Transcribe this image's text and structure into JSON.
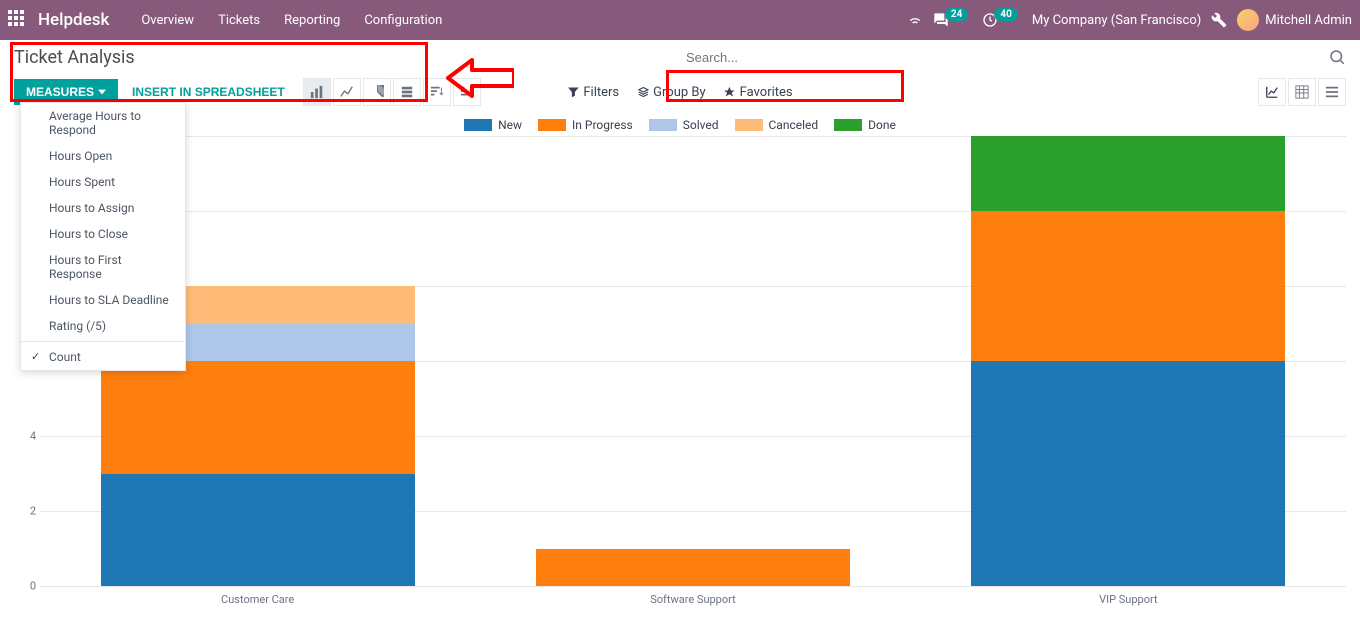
{
  "header": {
    "brand": "Helpdesk",
    "nav": [
      "Overview",
      "Tickets",
      "Reporting",
      "Configuration"
    ],
    "company": "My Company (San Francisco)",
    "user": "Mitchell Admin",
    "chat_badge": "24",
    "clock_badge": "40"
  },
  "title": "Ticket Analysis",
  "search": {
    "placeholder": "Search..."
  },
  "toolbar": {
    "measures": "MEASURES",
    "insert": "INSERT IN SPREADSHEET",
    "filters": "Filters",
    "groupby": "Group By",
    "favorites": "Favorites"
  },
  "measures_menu": {
    "items": [
      "Average Hours to Respond",
      "Hours Open",
      "Hours Spent",
      "Hours to Assign",
      "Hours to Close",
      "Hours to First Response",
      "Hours to SLA Deadline",
      "Rating (/5)"
    ],
    "checked": "Count"
  },
  "chart_data": {
    "type": "bar",
    "stacked": true,
    "categories": [
      "Customer Care",
      "Software Support",
      "VIP Support"
    ],
    "series": [
      {
        "name": "New",
        "color": "#1f77b4",
        "values": [
          3,
          0,
          6
        ]
      },
      {
        "name": "In Progress",
        "color": "#ff7f0e",
        "values": [
          3,
          1,
          4
        ]
      },
      {
        "name": "Solved",
        "color": "#aec7e8",
        "values": [
          1,
          0,
          0
        ]
      },
      {
        "name": "Canceled",
        "color": "#ffbb78",
        "values": [
          1,
          0,
          0
        ]
      },
      {
        "name": "Done",
        "color": "#2ca02c",
        "values": [
          0,
          0,
          2
        ]
      }
    ],
    "ylim": [
      0,
      12
    ],
    "yticks": [
      0,
      2,
      4,
      6,
      8,
      10,
      12
    ],
    "xlabel": "",
    "ylabel": "",
    "title": ""
  }
}
